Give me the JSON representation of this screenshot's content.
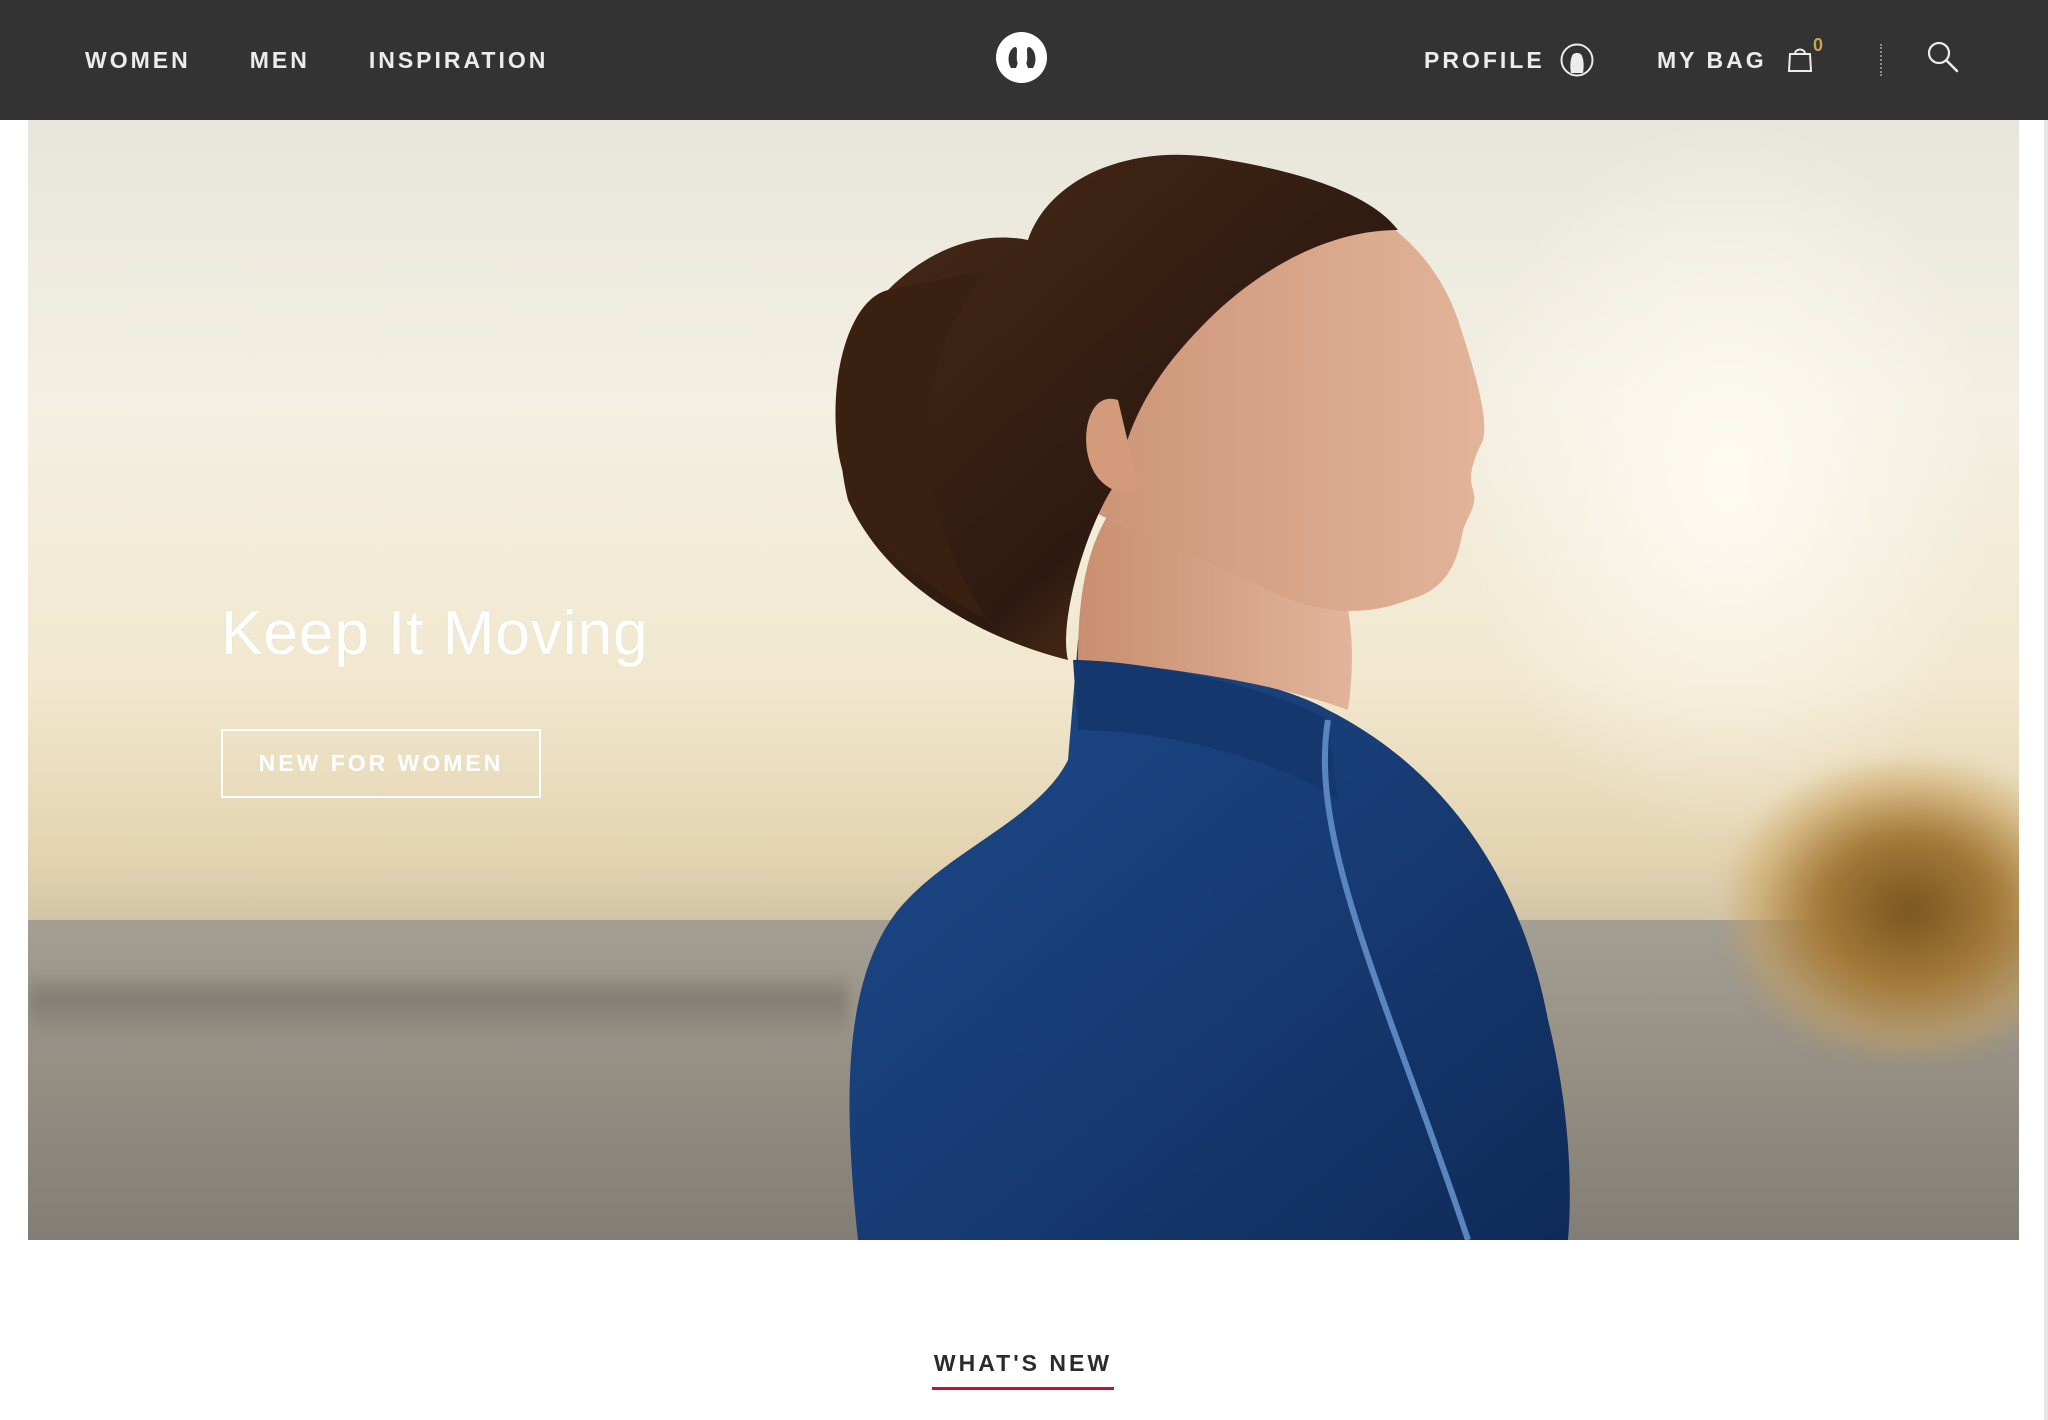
{
  "nav": {
    "left_links": [
      "WOMEN",
      "MEN",
      "INSPIRATION"
    ],
    "logo": "lululemon-logo-icon",
    "profile_label": "PROFILE",
    "bag_label": "MY BAG",
    "bag_count": "0",
    "icons": {
      "profile": "profile-icon",
      "bag": "shopping-bag-icon",
      "search": "search-icon"
    }
  },
  "hero": {
    "title": "Keep It Moving",
    "cta_label": "NEW FOR WOMEN"
  },
  "section": {
    "title": "WHAT'S NEW"
  },
  "colors": {
    "nav_background": "#333333",
    "bag_count": "#c8a35a",
    "section_underline": "#c8102e",
    "jacket": "#1c3f7a"
  }
}
